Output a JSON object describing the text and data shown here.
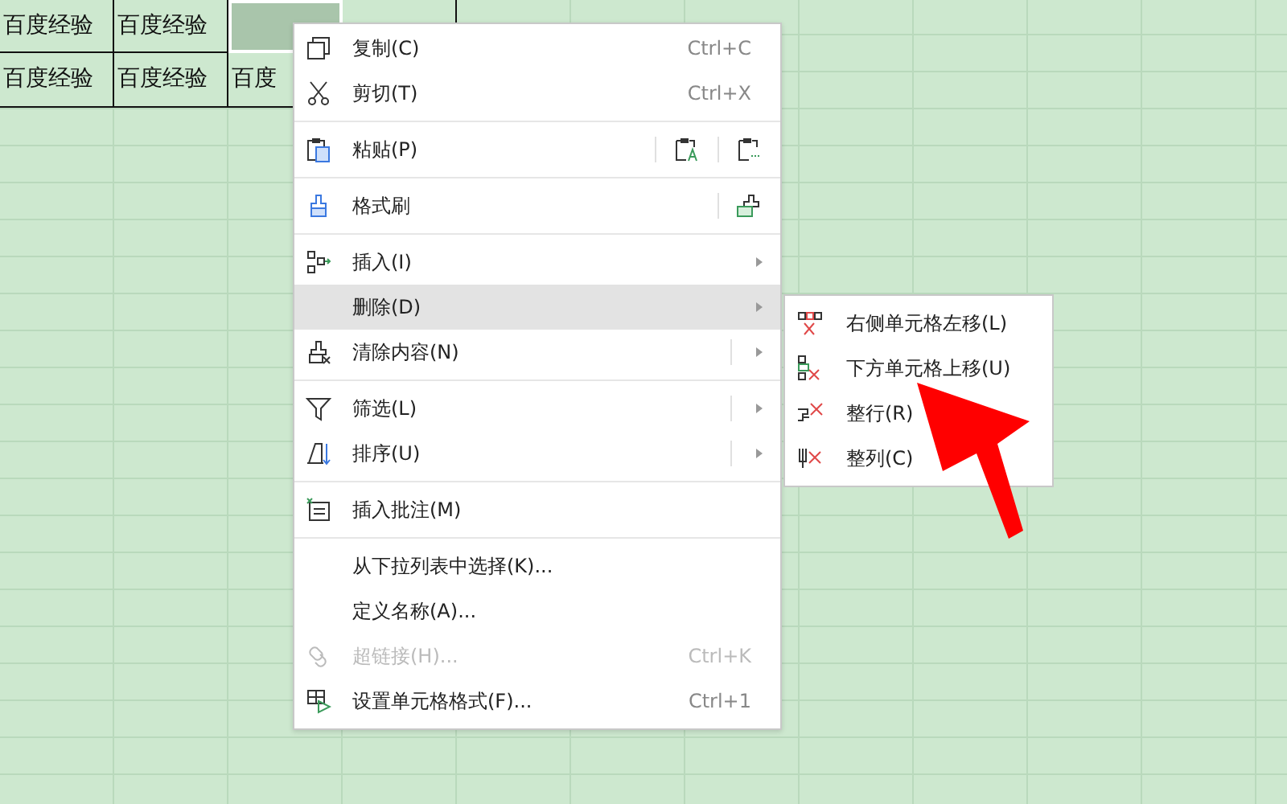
{
  "sheet": {
    "rows": [
      {
        "cells": [
          {
            "text": "百度经验",
            "selected": false
          },
          {
            "text": "百度经验",
            "selected": false
          },
          {
            "selected": true
          },
          {
            "selected": false
          }
        ]
      },
      {
        "cells": [
          {
            "text": "百度经验",
            "selected": false
          },
          {
            "text": "百度经验",
            "selected": false
          },
          {
            "text": "百度",
            "selected": false
          }
        ]
      }
    ]
  },
  "context_menu": {
    "items": [
      {
        "kind": "item",
        "label": "复制(C)",
        "shortcut": "Ctrl+C",
        "disabled": false,
        "selected": false
      },
      {
        "kind": "item",
        "label": "剪切(T)",
        "shortcut": "Ctrl+X",
        "disabled": false,
        "selected": false
      },
      {
        "kind": "separator"
      },
      {
        "kind": "item",
        "label": "粘贴(P)",
        "disabled": false,
        "selected": false
      },
      {
        "kind": "separator"
      },
      {
        "kind": "item",
        "label": "格式刷",
        "disabled": false,
        "selected": false
      },
      {
        "kind": "separator"
      },
      {
        "kind": "item",
        "label": "插入(I)",
        "submenu": true,
        "disabled": false,
        "selected": false
      },
      {
        "kind": "item",
        "label": "删除(D)",
        "submenu": true,
        "disabled": false,
        "selected": true
      },
      {
        "kind": "item",
        "label": "清除内容(N)",
        "submenu": true,
        "split": true,
        "disabled": false,
        "selected": false
      },
      {
        "kind": "separator"
      },
      {
        "kind": "item",
        "label": "筛选(L)",
        "submenu": true,
        "split": true,
        "disabled": false,
        "selected": false
      },
      {
        "kind": "item",
        "label": "排序(U)",
        "submenu": true,
        "split": true,
        "disabled": false,
        "selected": false
      },
      {
        "kind": "separator"
      },
      {
        "kind": "item",
        "label": "插入批注(M)",
        "disabled": false,
        "selected": false
      },
      {
        "kind": "separator"
      },
      {
        "kind": "item",
        "label": "从下拉列表中选择(K)...",
        "disabled": false,
        "selected": false
      },
      {
        "kind": "item",
        "label": "定义名称(A)...",
        "disabled": false,
        "selected": false
      },
      {
        "kind": "item",
        "label": "超链接(H)...",
        "shortcut": "Ctrl+K",
        "disabled": true,
        "selected": false
      },
      {
        "kind": "item",
        "label": "设置单元格格式(F)...",
        "shortcut": "Ctrl+1",
        "disabled": false,
        "selected": false
      }
    ]
  },
  "submenu": {
    "items": [
      {
        "label": "右侧单元格左移(L)"
      },
      {
        "label": "下方单元格上移(U)"
      },
      {
        "label": "整行(R)"
      },
      {
        "label": "整列(C)"
      }
    ]
  }
}
